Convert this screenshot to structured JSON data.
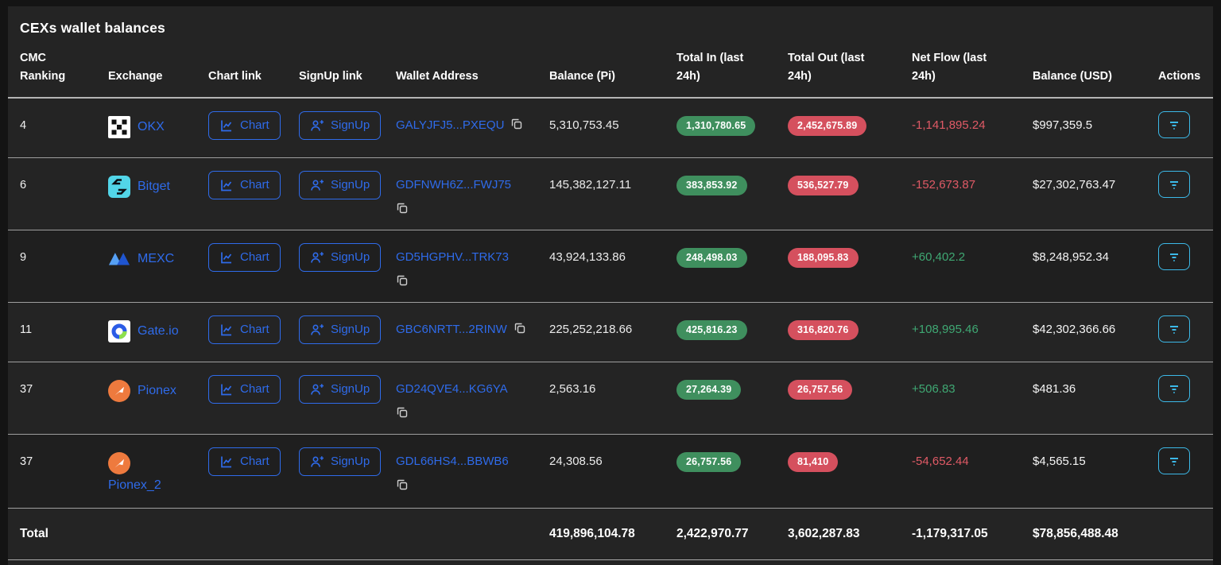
{
  "title": "CEXs wallet balances",
  "labels": {
    "chart": "Chart",
    "signup": "SignUp"
  },
  "icons": {
    "chart": "line-chart-icon",
    "signup": "person-plus-icon",
    "copy": "copy-icon",
    "actions": "filter-icon"
  },
  "colors": {
    "card_bg": "#242424",
    "outer_bg": "#141414",
    "link_blue": "#2f6bea",
    "pill_green": "#3f8f5e",
    "pill_red": "#d5505e",
    "net_negative": "#e05a66",
    "net_positive": "#3fa873",
    "action_cyan": "#3cb9e8"
  },
  "table": {
    "columns": [
      "CMC Ranking",
      "Exchange",
      "Chart link",
      "SignUp link",
      "Wallet Address",
      "Balance (Pi)",
      "Total In (last 24h)",
      "Total Out (last 24h)",
      "Net Flow (last 24h)",
      "Balance (USD)",
      "Actions"
    ],
    "rows": [
      {
        "rank": "4",
        "exchange": "OKX",
        "wallet": "GALYJFJ5...PXEQU",
        "balance_pi": "5,310,753.45",
        "total_in": "1,310,780.65",
        "total_out": "2,452,675.89",
        "net_flow": "-1,141,895.24",
        "balance_usd": "$997,359.5"
      },
      {
        "rank": "6",
        "exchange": "Bitget",
        "wallet": "GDFNWH6Z...FWJ75",
        "balance_pi": "145,382,127.11",
        "total_in": "383,853.92",
        "total_out": "536,527.79",
        "net_flow": "-152,673.87",
        "balance_usd": "$27,302,763.47"
      },
      {
        "rank": "9",
        "exchange": "MEXC",
        "wallet": "GD5HGPHV...TRK73",
        "balance_pi": "43,924,133.86",
        "total_in": "248,498.03",
        "total_out": "188,095.83",
        "net_flow": "+60,402.2",
        "balance_usd": "$8,248,952.34"
      },
      {
        "rank": "11",
        "exchange": "Gate.io",
        "wallet": "GBC6NRTT...2RINW",
        "balance_pi": "225,252,218.66",
        "total_in": "425,816.23",
        "total_out": "316,820.76",
        "net_flow": "+108,995.46",
        "balance_usd": "$42,302,366.66"
      },
      {
        "rank": "37",
        "exchange": "Pionex",
        "wallet": "GD24QVE4...KG6YA",
        "balance_pi": "2,563.16",
        "total_in": "27,264.39",
        "total_out": "26,757.56",
        "net_flow": "+506.83",
        "balance_usd": "$481.36"
      },
      {
        "rank": "37",
        "exchange": "Pionex_2",
        "wallet": "GDL66HS4...BBWB6",
        "balance_pi": "24,308.56",
        "total_in": "26,757.56",
        "total_out": "81,410",
        "net_flow": "-54,652.44",
        "balance_usd": "$4,565.15"
      }
    ],
    "total": {
      "label": "Total",
      "balance_pi": "419,896,104.78",
      "total_in": "2,422,970.77",
      "total_out": "3,602,287.83",
      "net_flow": "-1,179,317.05",
      "balance_usd": "$78,856,488.48"
    }
  }
}
